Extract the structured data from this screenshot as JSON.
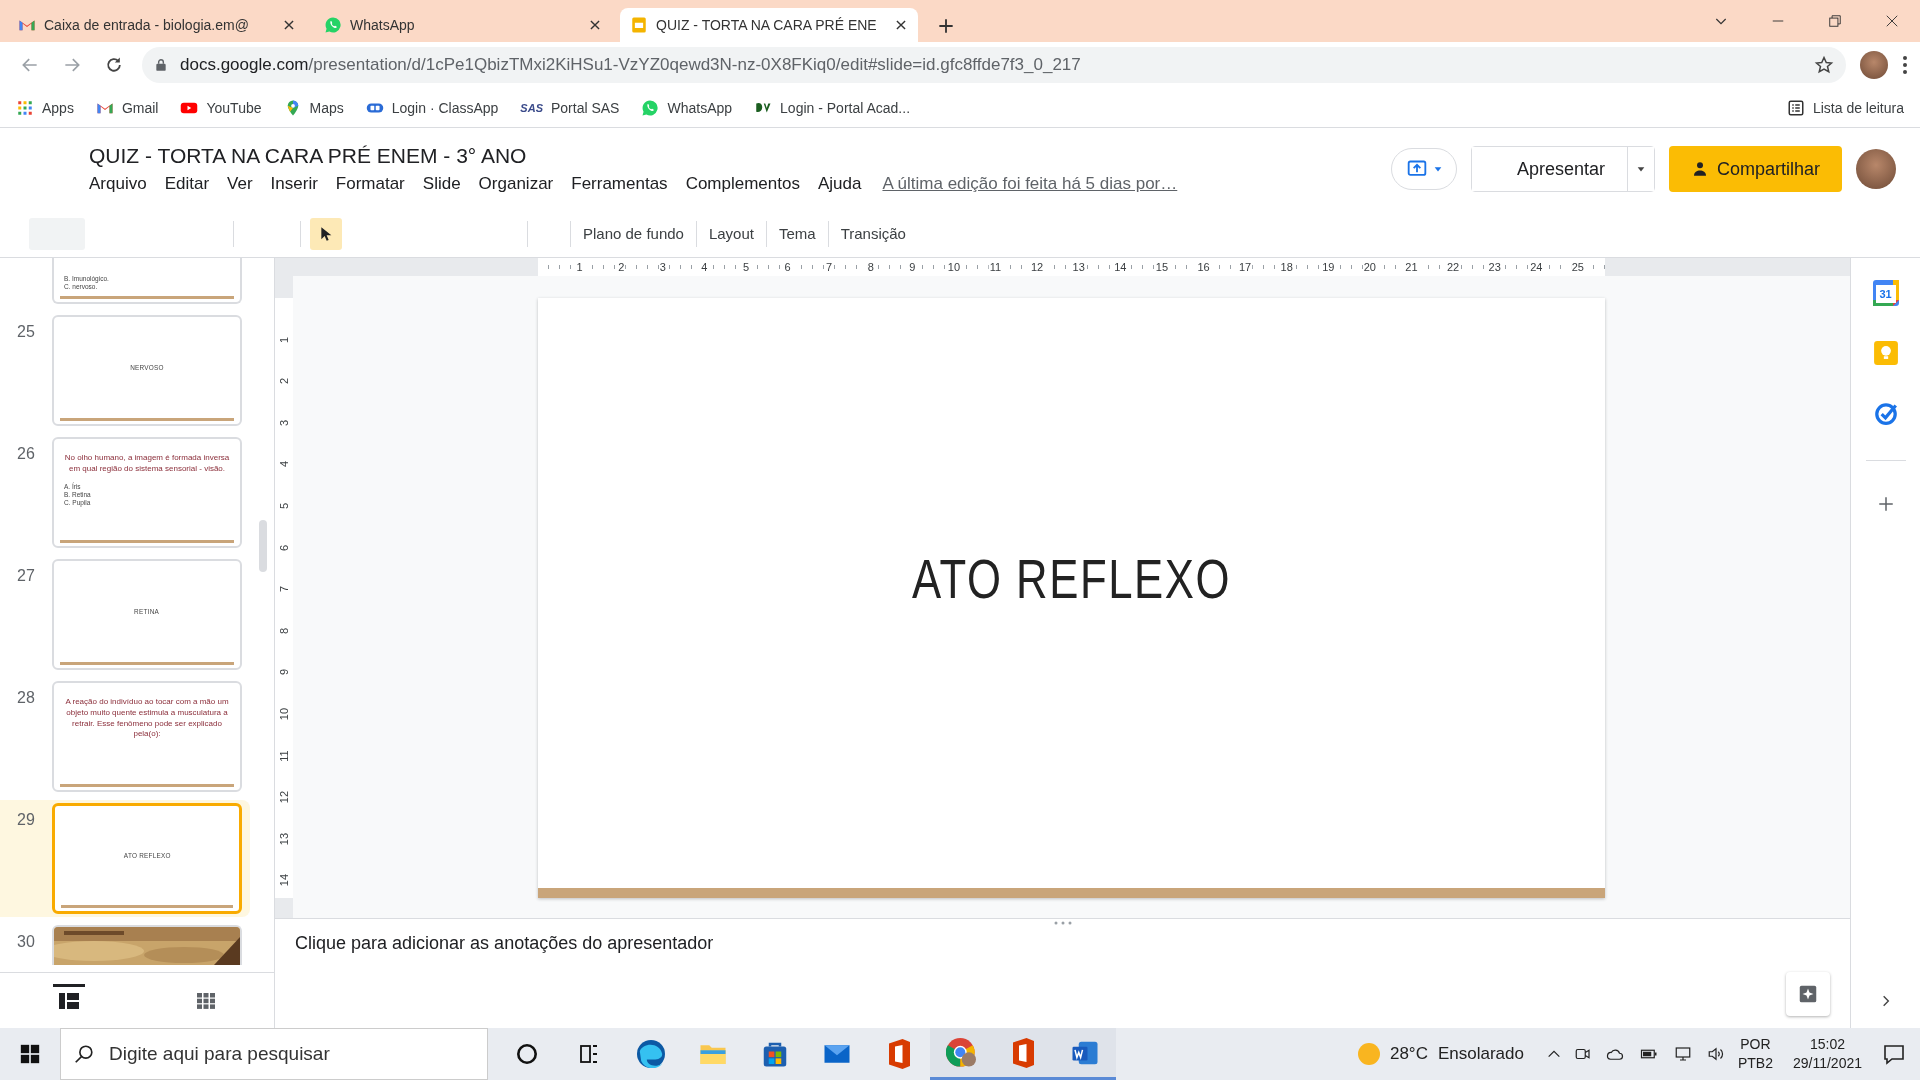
{
  "browser": {
    "tabs": [
      {
        "kind": "gmail",
        "title": "Caixa de entrada - biologia.em@",
        "selected": false
      },
      {
        "kind": "whatsapp",
        "title": "WhatsApp",
        "selected": false
      },
      {
        "kind": "slides",
        "title": "QUIZ - TORTA NA CARA PRÉ ENE",
        "selected": true
      }
    ],
    "url": {
      "host": "docs.google.com",
      "path": "/presentation/d/1cPe1QbizTMxi2KiHSu1-VzYZ0qewd3N-nz-0X8FKiq0/edit#slide=id.gfc8ffde7f3_0_217"
    },
    "bookmarks": [
      {
        "kind": "apps",
        "label": "Apps"
      },
      {
        "kind": "gmail",
        "label": "Gmail"
      },
      {
        "kind": "youtube",
        "label": "YouTube"
      },
      {
        "kind": "maps",
        "label": "Maps"
      },
      {
        "kind": "classapp",
        "label": "Login · ClassApp"
      },
      {
        "kind": "sas",
        "logo_text": "SAS",
        "label": "Portal SAS"
      },
      {
        "kind": "whatsapp",
        "label": "WhatsApp"
      },
      {
        "kind": "portal",
        "label": "Login - Portal Acad..."
      }
    ],
    "reading_list": "Lista de leitura"
  },
  "docs": {
    "title": "QUIZ - TORTA NA CARA PRÉ ENEM - 3° ANO",
    "menu": [
      "Arquivo",
      "Editar",
      "Ver",
      "Inserir",
      "Formatar",
      "Slide",
      "Organizar",
      "Ferramentas",
      "Complementos",
      "Ajuda"
    ],
    "last_edit": "A última edição foi feita há 5 dias por…",
    "present": "Apresentar",
    "share": "Compartilhar",
    "toolbar": [
      "Plano de fundo",
      "Layout",
      "Tema",
      "Transição"
    ]
  },
  "slides": [
    {
      "kind": "partial",
      "options": [
        "B.  Imunológico.",
        "C.  nervoso."
      ],
      "selected": false
    },
    {
      "kind": "title",
      "number": "25",
      "text": "NERVOSO",
      "selected": false
    },
    {
      "kind": "question",
      "number": "26",
      "text": "No olho humano, a imagem é formada inversa em qual região do sistema sensorial - visão.",
      "options": [
        "A.  Íris",
        "B.  Retina",
        "C.  Pupila"
      ],
      "selected": false
    },
    {
      "kind": "title",
      "number": "27",
      "text": "RETINA",
      "selected": false
    },
    {
      "kind": "question",
      "number": "28",
      "text": "A reação do indivíduo ao tocar com a mão um objeto muito quente estimula a musculatura a retrair. Esse fenômeno pode ser explicado pela(o):",
      "selected": false
    },
    {
      "kind": "title",
      "number": "29",
      "text": "ATO REFLEXO",
      "selected": true
    },
    {
      "kind": "picture",
      "number": "30",
      "selected": false
    }
  ],
  "ruler": {
    "horizontal": [
      "1",
      "2",
      "3",
      "4",
      "5",
      "6",
      "7",
      "8",
      "9",
      "10",
      "11",
      "12",
      "13",
      "14",
      "15",
      "16",
      "17",
      "18",
      "19",
      "20",
      "21",
      "22",
      "23",
      "24",
      "25"
    ],
    "vertical": [
      "1",
      "2",
      "3",
      "4",
      "5",
      "6",
      "7",
      "8",
      "9",
      "10",
      "11",
      "12",
      "13",
      "14"
    ]
  },
  "slide": {
    "title": "ATO REFLEXO"
  },
  "notes": {
    "placeholder": "Clique para adicionar as anotações do apresentador"
  },
  "side_panel": [
    {
      "kind": "calendar",
      "label": "31"
    },
    {
      "kind": "keep"
    },
    {
      "kind": "tasks"
    }
  ],
  "taskbar": {
    "search": {
      "placeholder": "Digite aqui para pesquisar"
    },
    "apps": [
      {
        "kind": "cortana",
        "active": false
      },
      {
        "kind": "taskview",
        "active": false
      },
      {
        "kind": "edge",
        "active": false
      },
      {
        "kind": "explorer",
        "active": false
      },
      {
        "kind": "store",
        "active": false
      },
      {
        "kind": "mail",
        "active": false
      },
      {
        "kind": "office",
        "active": false
      },
      {
        "kind": "chrome",
        "active": true
      },
      {
        "kind": "office",
        "active": true
      },
      {
        "kind": "word",
        "active": true
      }
    ],
    "weather": {
      "temperature": "28°C",
      "condition": "Ensolarado"
    },
    "language": "POR",
    "layout": "PTB2",
    "time": "15:02",
    "date": "29/11/2021"
  }
}
